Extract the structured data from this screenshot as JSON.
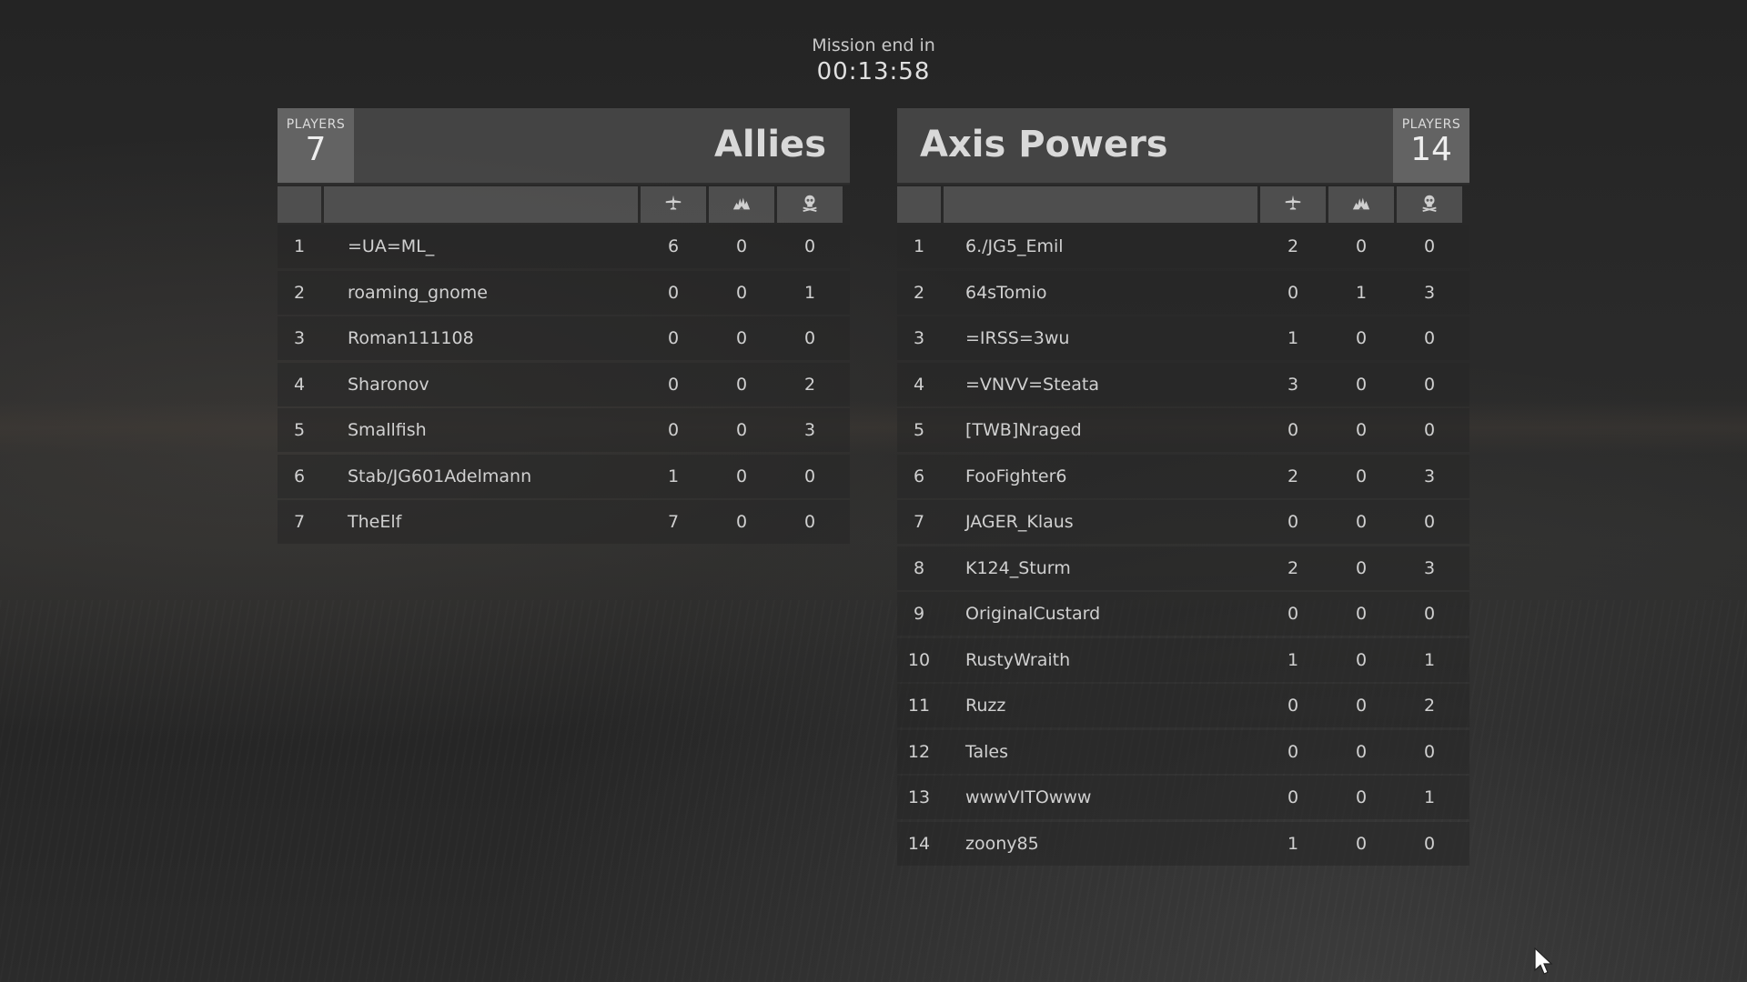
{
  "timer": {
    "label": "Mission end in",
    "value": "00:13:58"
  },
  "icons": {
    "col1": "plane-icon",
    "col2": "crash-icon",
    "col3": "skull-icon"
  },
  "allies": {
    "name": "Allies",
    "players_label": "PLAYERS",
    "players_count": "7",
    "rows": [
      {
        "rank": "1",
        "name": "=UA=ML_",
        "s1": "6",
        "s2": "0",
        "s3": "0"
      },
      {
        "rank": "2",
        "name": "roaming_gnome",
        "s1": "0",
        "s2": "0",
        "s3": "1"
      },
      {
        "rank": "3",
        "name": "Roman111108",
        "s1": "0",
        "s2": "0",
        "s3": "0"
      },
      {
        "rank": "4",
        "name": "Sharonov",
        "s1": "0",
        "s2": "0",
        "s3": "2"
      },
      {
        "rank": "5",
        "name": "Smallfish",
        "s1": "0",
        "s2": "0",
        "s3": "3"
      },
      {
        "rank": "6",
        "name": "Stab/JG601Adelmann",
        "s1": "1",
        "s2": "0",
        "s3": "0"
      },
      {
        "rank": "7",
        "name": "TheElf",
        "s1": "7",
        "s2": "0",
        "s3": "0"
      }
    ]
  },
  "axis": {
    "name": "Axis Powers",
    "players_label": "PLAYERS",
    "players_count": "14",
    "rows": [
      {
        "rank": "1",
        "name": "6./JG5_Emil",
        "s1": "2",
        "s2": "0",
        "s3": "0"
      },
      {
        "rank": "2",
        "name": "64sTomio",
        "s1": "0",
        "s2": "1",
        "s3": "3"
      },
      {
        "rank": "3",
        "name": "=IRSS=3wu",
        "s1": "1",
        "s2": "0",
        "s3": "0"
      },
      {
        "rank": "4",
        "name": "=VNVV=Steata",
        "s1": "3",
        "s2": "0",
        "s3": "0"
      },
      {
        "rank": "5",
        "name": "[TWB]Nraged",
        "s1": "0",
        "s2": "0",
        "s3": "0"
      },
      {
        "rank": "6",
        "name": "FooFighter6",
        "s1": "2",
        "s2": "0",
        "s3": "3"
      },
      {
        "rank": "7",
        "name": "JAGER_Klaus",
        "s1": "0",
        "s2": "0",
        "s3": "0"
      },
      {
        "rank": "8",
        "name": "K124_Sturm",
        "s1": "2",
        "s2": "0",
        "s3": "3"
      },
      {
        "rank": "9",
        "name": "OriginalCustard",
        "s1": "0",
        "s2": "0",
        "s3": "0"
      },
      {
        "rank": "10",
        "name": "RustyWraith",
        "s1": "1",
        "s2": "0",
        "s3": "1"
      },
      {
        "rank": "11",
        "name": "Ruzz",
        "s1": "0",
        "s2": "0",
        "s3": "2"
      },
      {
        "rank": "12",
        "name": "Tales",
        "s1": "0",
        "s2": "0",
        "s3": "0"
      },
      {
        "rank": "13",
        "name": "wwwVITOwww",
        "s1": "0",
        "s2": "0",
        "s3": "1"
      },
      {
        "rank": "14",
        "name": "zoony85",
        "s1": "1",
        "s2": "0",
        "s3": "0"
      }
    ]
  }
}
